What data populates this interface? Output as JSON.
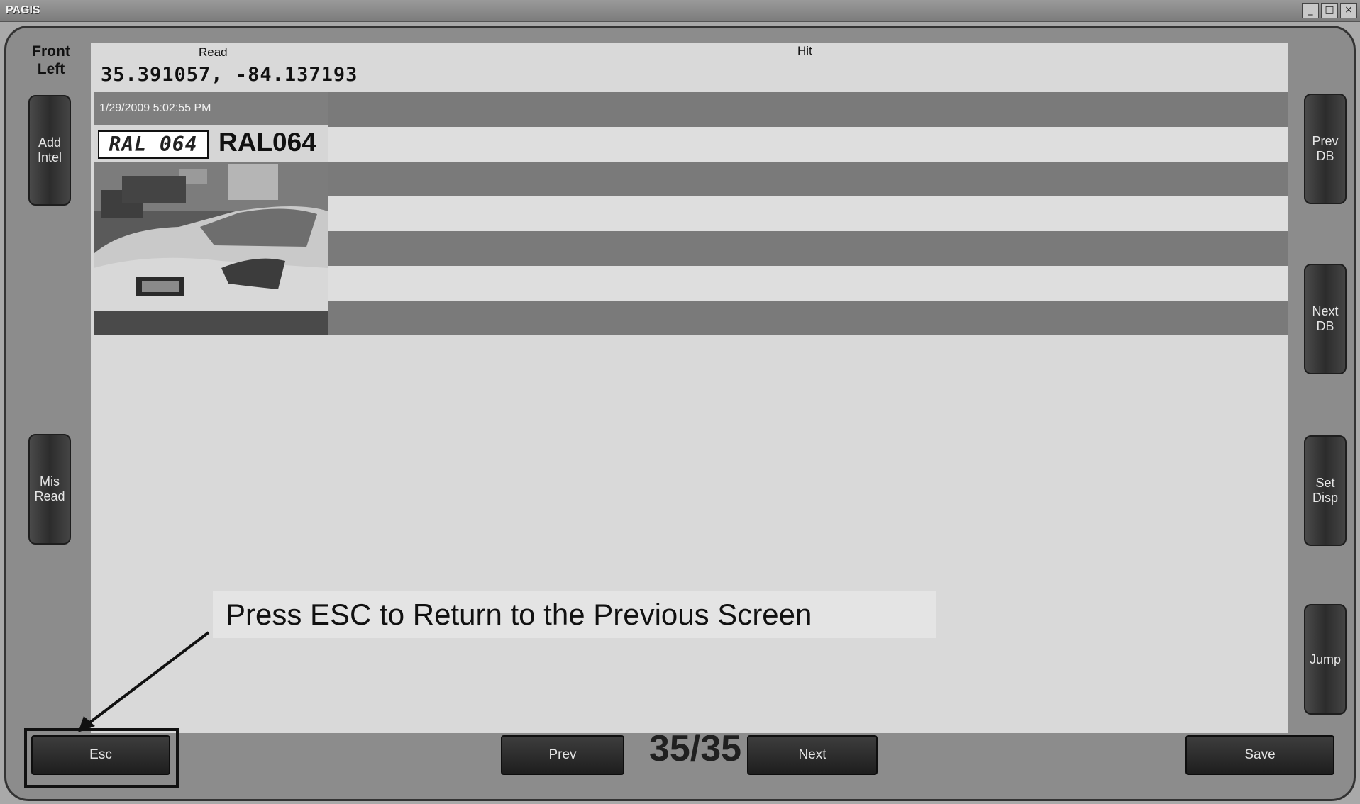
{
  "window": {
    "title": "PAGIS",
    "controls": [
      "_",
      "□",
      "×"
    ]
  },
  "camera": {
    "label": "Front\nLeft"
  },
  "left_buttons": {
    "add_intel": "Add\nIntel",
    "mis_read": "Mis\nRead"
  },
  "right_buttons": {
    "prev_db": "Prev\nDB",
    "next_db": "Next\nDB",
    "set_disp": "Set\nDisp",
    "jump": "Jump"
  },
  "columns": {
    "read": "Read",
    "hit": "Hit"
  },
  "coordinates": "35.391057, -84.137193",
  "read_entry": {
    "timestamp": "1/29/2009 5:02:55 PM",
    "plate_crop": "RAL 064",
    "plate_number": "RAL064"
  },
  "annotation": {
    "text": "Press ESC to Return to the Previous Screen"
  },
  "bottom_bar": {
    "esc": "Esc",
    "prev": "Prev",
    "counter": "35/35",
    "next": "Next",
    "save": "Save"
  }
}
